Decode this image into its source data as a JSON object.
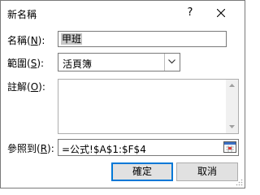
{
  "window": {
    "title": "新名稱",
    "help_label": "?"
  },
  "fields": {
    "name_label_pre": "名稱(",
    "name_label_key": "N",
    "name_label_post": "):",
    "name_value": "甲班",
    "scope_label_pre": "範圍(",
    "scope_label_key": "S",
    "scope_label_post": "):",
    "scope_value": "活頁簿",
    "comment_label_pre": "註解(",
    "comment_label_key": "O",
    "comment_label_post": "):",
    "comment_value": "",
    "ref_label_pre": "參照到(",
    "ref_label_key": "R",
    "ref_label_post": "):",
    "ref_value": "=公式!$A$1:$F$4"
  },
  "buttons": {
    "ok_label": "確定",
    "cancel_label": "取消"
  },
  "colors": {
    "default_button_border": "#0078d7",
    "button_face": "#e1e1e1",
    "selection": "#c7c7c7"
  }
}
